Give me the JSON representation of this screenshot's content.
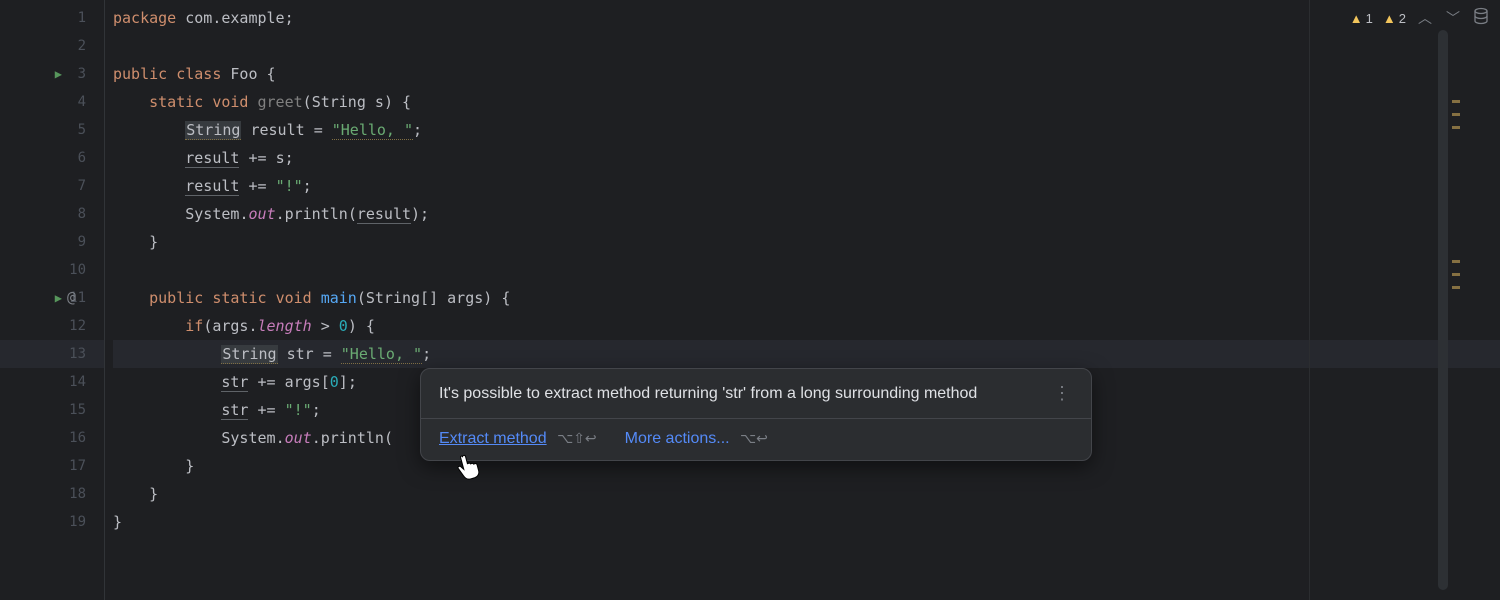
{
  "gutter": {
    "lines": [
      "1",
      "2",
      "3",
      "4",
      "5",
      "6",
      "7",
      "8",
      "9",
      "10",
      "11",
      "12",
      "13",
      "14",
      "15",
      "16",
      "17",
      "18",
      "19"
    ]
  },
  "code": {
    "package_kw": "package",
    "package_name": " com.example",
    "public_kw": "public",
    "class_kw": "class",
    "class_name": "Foo",
    "static_kw": "static",
    "void_kw": "void",
    "greet": "greet",
    "string_type": "String",
    "s_param": "s",
    "result_var": "result",
    "hello_str": "\"Hello, \"",
    "excl_str": "\"!\"",
    "system": "System",
    "out": "out",
    "println": "println",
    "main": "main",
    "args": "args",
    "string_arr": "String[]",
    "if_kw": "if",
    "length": "length",
    "gt": ">",
    "zero": "0",
    "str_var": "str",
    "args_idx": "args[",
    "idx": "0",
    "close_idx": "]"
  },
  "warnings": {
    "w1": "1",
    "w2": "2"
  },
  "tooltip": {
    "message": "It's possible to extract method returning 'str' from a long surrounding method",
    "action1": "Extract method",
    "shortcut1": "⌥⇧↩",
    "action2": "More actions...",
    "shortcut2": "⌥↩"
  }
}
